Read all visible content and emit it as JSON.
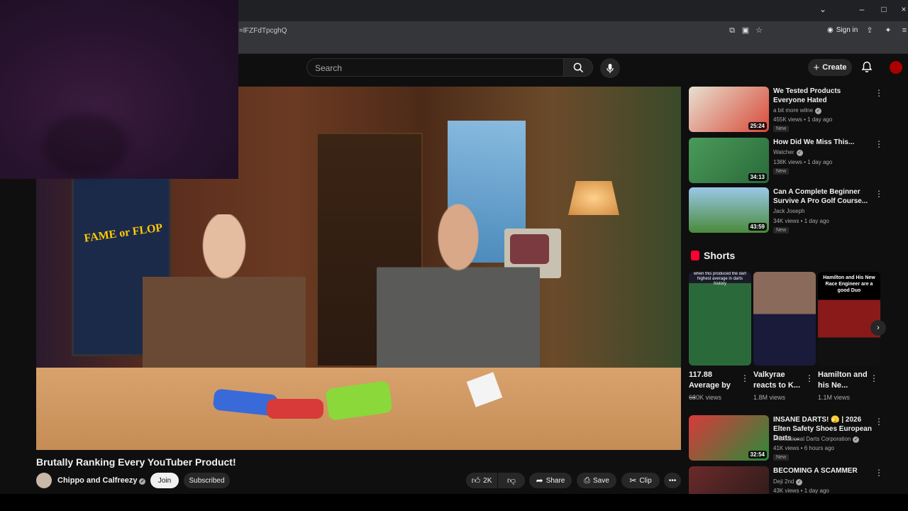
{
  "browser": {
    "url": "=lFZFdTpcghQ",
    "sign_in": "Sign in",
    "window_min": "–",
    "window_max": "□",
    "window_close": "×"
  },
  "header": {
    "search_placeholder": "Search",
    "create_label": "Create"
  },
  "video": {
    "title": "Brutally Ranking Every YouTuber Product!",
    "board_text": "FAME or FLOP"
  },
  "channel": {
    "name": "Chippo and Calfreezy",
    "join_label": "Join",
    "subscribed_label": "Subscribed"
  },
  "actions": {
    "likes": "2K",
    "share": "Share",
    "save": "Save",
    "clip": "Clip",
    "more": "•••"
  },
  "recommendations": [
    {
      "title": "We Tested Products Everyone Hated",
      "channel": "a bit more wilne",
      "meta": "455K views • 1 day ago",
      "badge": "New",
      "duration": "25:24",
      "color": "#d84a3a"
    },
    {
      "title": "How Did We Miss This...",
      "channel": "Watcher",
      "meta": "138K views • 1 day ago",
      "badge": "New",
      "duration": "34:13",
      "color": "#2a8a4a"
    },
    {
      "title": "Can A Complete Beginner Survive A Pro Golf Course...",
      "channel": "Jack Joseph",
      "meta": "34K views • 1 day ago",
      "badge": "New",
      "duration": "43:59",
      "color": "#3a8a3a"
    },
    {
      "title": "INSANE DARTS! 🫣 | 2026 Elten Safety Shoes European Darts ...",
      "channel": "Professional Darts Corporation",
      "meta": "41K views • 6 hours ago",
      "badge": "New",
      "duration": "32:54",
      "color": "#b82a2a"
    },
    {
      "title": "BECOMING A SCAMMER",
      "channel": "Deji 2nd",
      "meta": "43K views • 1 day ago",
      "badge": "",
      "duration": "",
      "color": "#6a2a2a"
    }
  ],
  "shorts": {
    "heading": "Shorts",
    "items": [
      {
        "title": "117.88 Average by ...",
        "views": "680K views",
        "overlay": "when this produced the dart highest average in darts history",
        "color": "#2a6a3a"
      },
      {
        "title": "Valkyrae reacts to K...",
        "views": "1.8M views",
        "overlay": "",
        "color": "#5a4a3a"
      },
      {
        "title": "Hamilton and his Ne...",
        "views": "1.1M views",
        "overlay": "Hamilton and His New Race Engineer are a good Duo",
        "color": "#8a1a1a"
      }
    ]
  }
}
